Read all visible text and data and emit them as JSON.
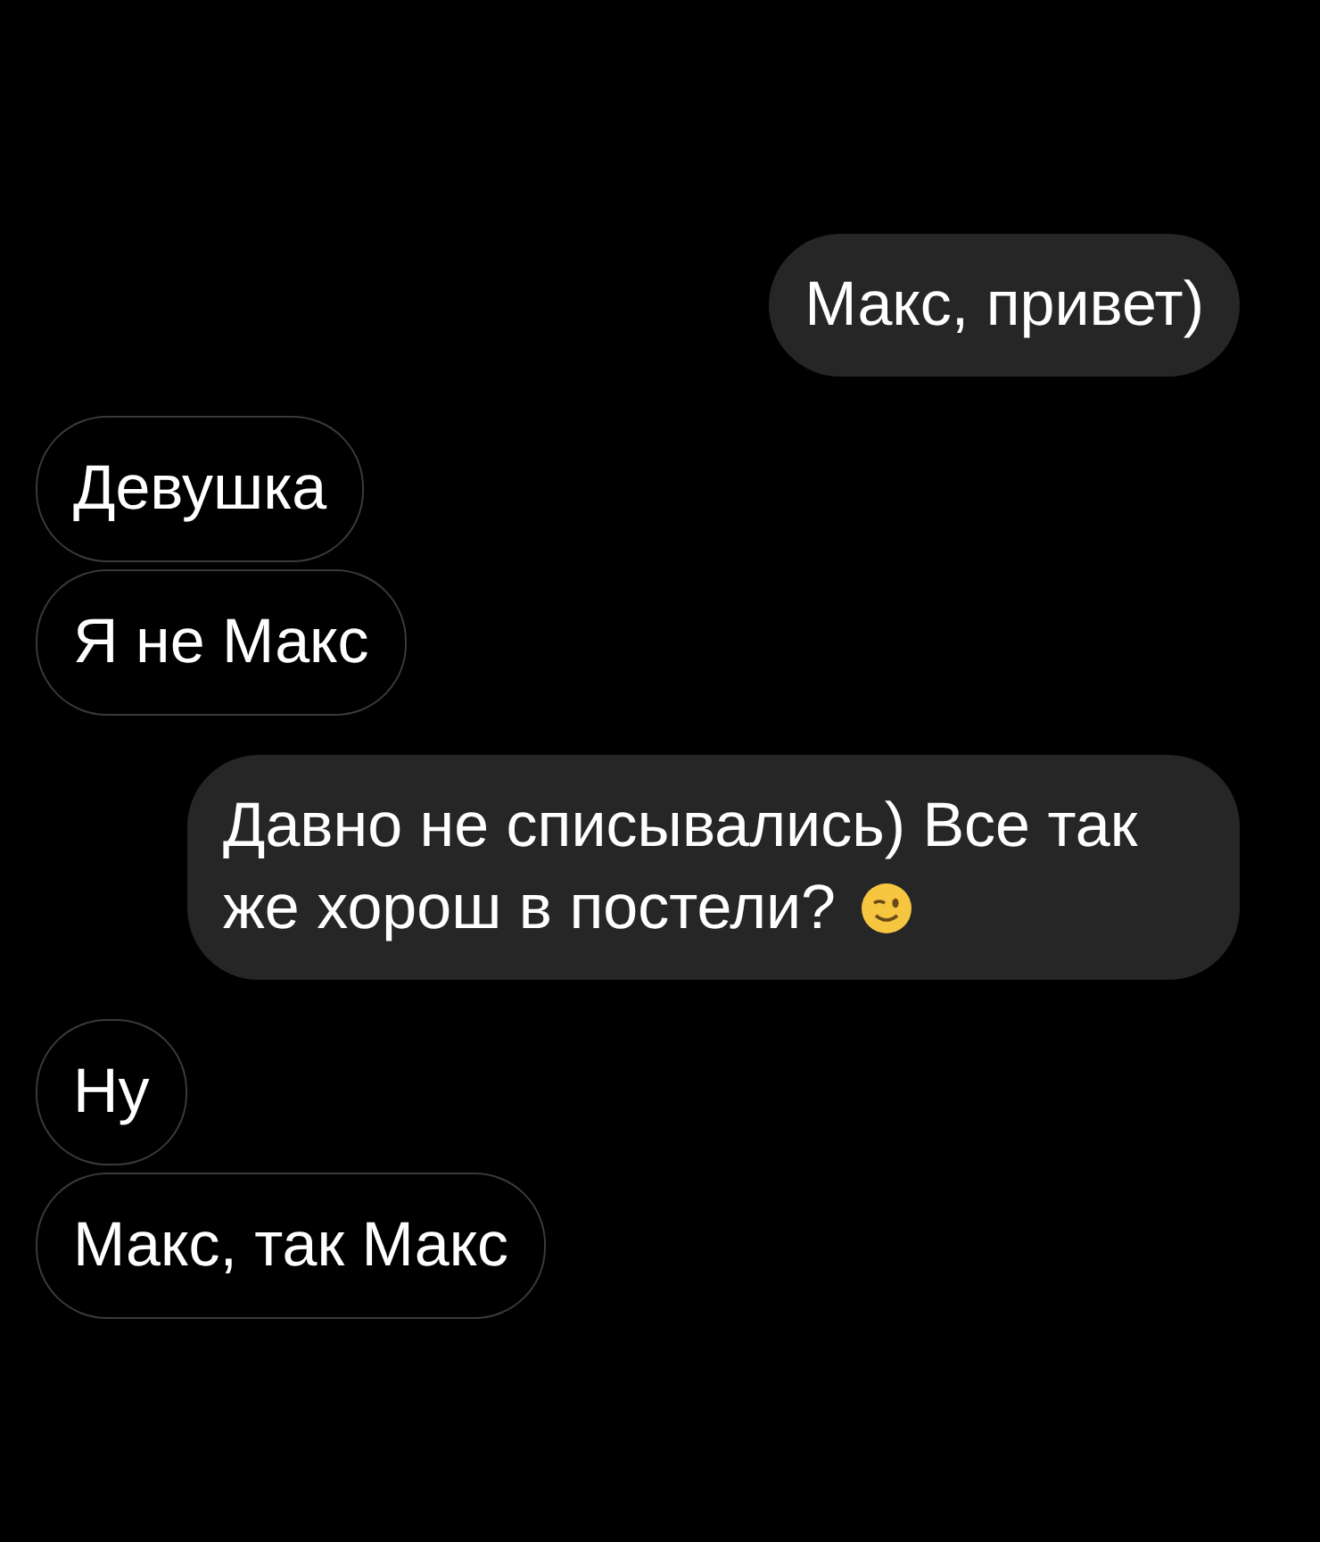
{
  "messages": [
    {
      "kind": "outgoing",
      "text": "Макс, привет)",
      "emoji": false
    },
    {
      "kind": "incoming",
      "text": "Девушка",
      "emoji": false
    },
    {
      "kind": "incoming",
      "text": "Я не Макс",
      "emoji": false
    },
    {
      "kind": "outgoing",
      "text": "Давно не списывались) Все так же хорош в постели?",
      "emoji": true
    },
    {
      "kind": "incoming",
      "text": "Ну",
      "emoji": false
    },
    {
      "kind": "incoming",
      "text": "Макс, так Макс",
      "emoji": false
    }
  ]
}
